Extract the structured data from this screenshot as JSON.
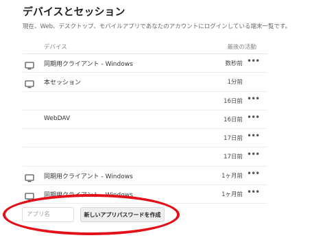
{
  "page": {
    "title": "デバイスとセッション",
    "description": "現在、Web、デスクトップ、モバイルアプリであなたのアカウントにログインしている端末一覧です。"
  },
  "table": {
    "headers": {
      "device": "デバイス",
      "last_activity": "最後の活動"
    },
    "rows": [
      {
        "icon": "monitor-icon",
        "name": "同期用クライアント - Windows",
        "when": "数秒前",
        "more": "•••"
      },
      {
        "icon": "monitor-icon",
        "name": "本セッション",
        "when": "1分前",
        "more": ""
      },
      {
        "icon": "",
        "name": "",
        "when": "16日前",
        "more": "•••"
      },
      {
        "icon": "",
        "name": "WebDAV",
        "when": "16日前",
        "more": "•••"
      },
      {
        "icon": "",
        "name": "",
        "when": "17日前",
        "more": "•••"
      },
      {
        "icon": "",
        "name": "",
        "when": "17日前",
        "more": "•••"
      },
      {
        "icon": "monitor-icon",
        "name": "同期用クライアント - Windows",
        "when": "1ヶ月前",
        "more": "•••"
      },
      {
        "icon": "monitor-icon",
        "name": "同期用クライアント - Windows",
        "when": "1ヶ月前",
        "more": "•••"
      }
    ]
  },
  "app_password": {
    "placeholder": "アプリ名",
    "button_label": "新しいアプリパスワードを作成"
  },
  "colors": {
    "highlight": "#e3101a"
  }
}
